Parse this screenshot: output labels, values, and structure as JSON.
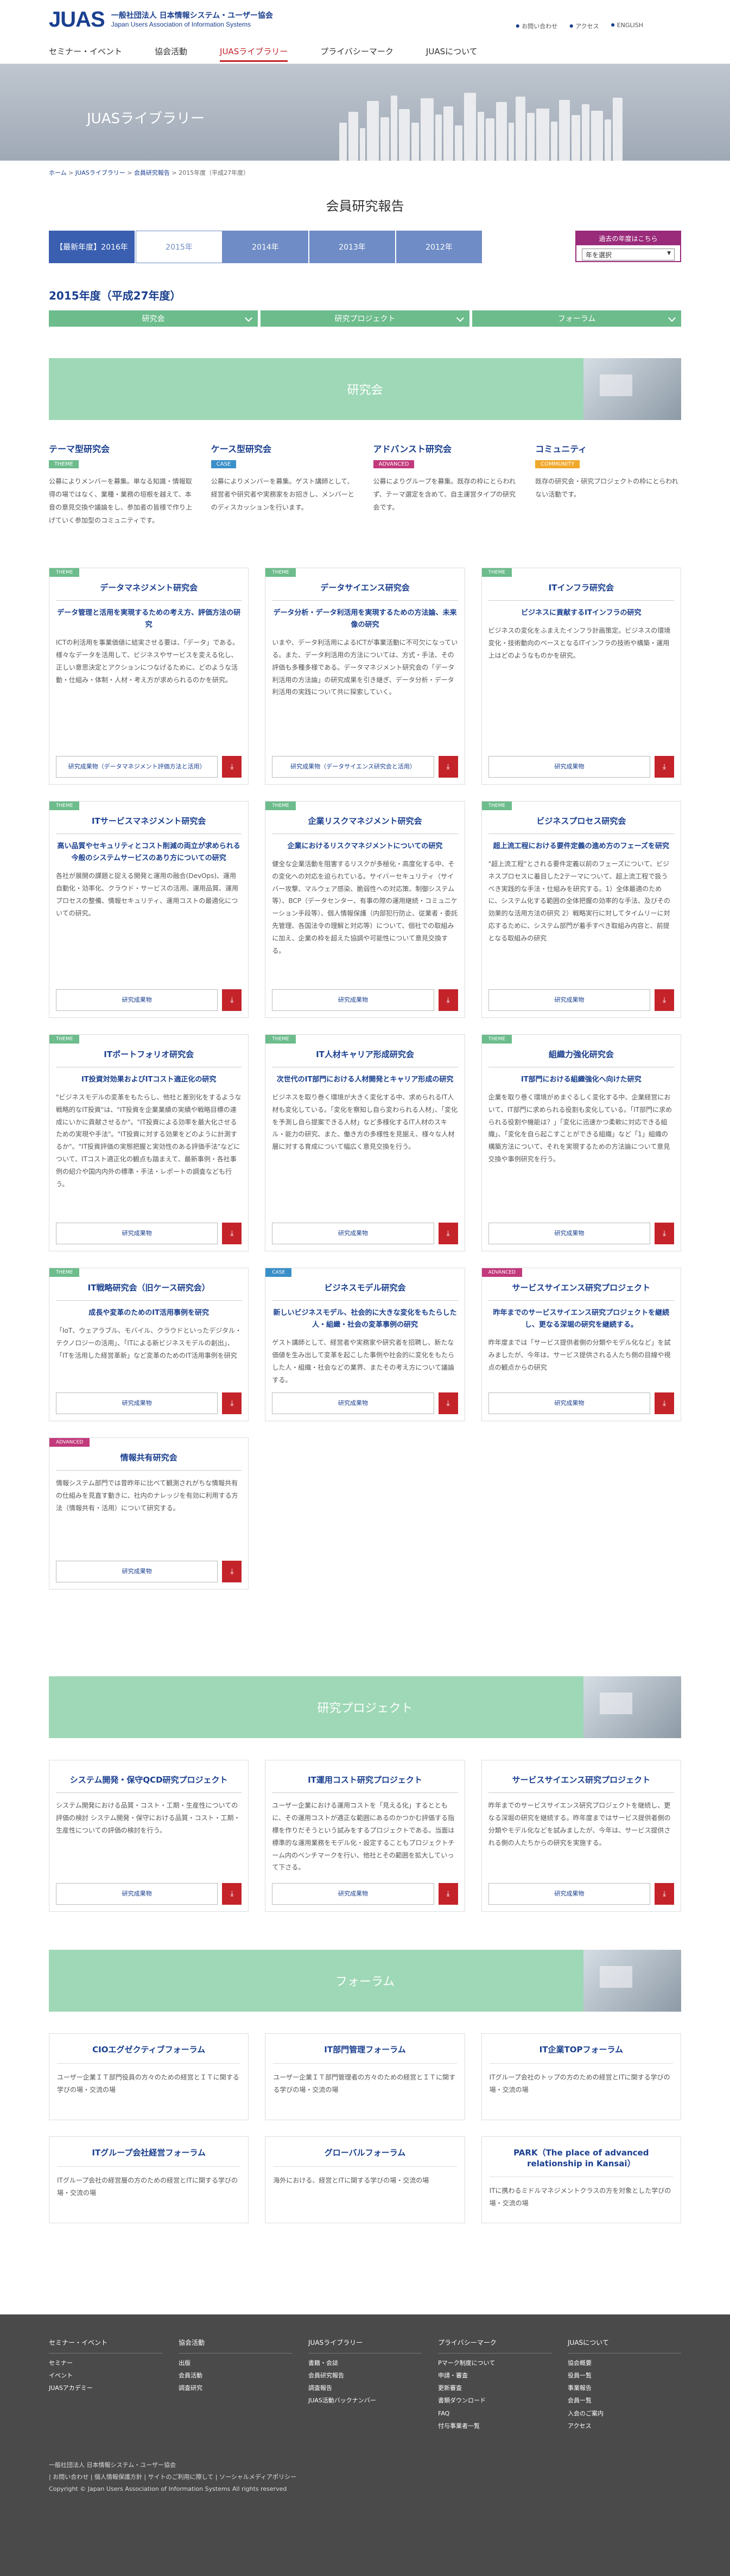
{
  "header": {
    "logo_mark": "JUAS",
    "logo_jp": "一般社団法人 日本情報システム・ユーザー協会",
    "logo_en": "Japan Users Association of Information Systems",
    "util": [
      "お問い合わせ",
      "アクセス",
      "ENGLISH"
    ],
    "nav": [
      "セミナー・イベント",
      "協会活動",
      "JUASライブラリー",
      "プライバシーマーク",
      "JUASについて"
    ]
  },
  "hero": {
    "title": "JUASライブラリー"
  },
  "breadcrumb": [
    "ホーム",
    "JUASライブラリー",
    "会員研究報告",
    "2015年度（平成27年度）"
  ],
  "page_title": "会員研究報告",
  "years": {
    "tabs": [
      "【最新年度】2016年",
      "2015年",
      "2014年",
      "2013年",
      "2012年"
    ],
    "select_header": "過去の年度はこちら",
    "select_value": "年を選択"
  },
  "year_title": "2015年度（平成27年度）",
  "categories": [
    "研究会",
    "研究プロジェクト",
    "フォーラム"
  ],
  "sections": {
    "kenkyukai": "研究会",
    "project": "研究プロジェクト",
    "forum": "フォーラム"
  },
  "intro": [
    {
      "title": "テーマ型研究会",
      "badge": "THEME",
      "text": "公募によりメンバーを募集。単なる知識・情報取得の場ではなく、業種・業務の垣根を越えて、本音の意見交換や議論をし、参加者の皆様で作り上げていく参加型のコミュニティです。"
    },
    {
      "title": "ケース型研究会",
      "badge": "CASE",
      "text": "公募によりメンバーを募集。ゲスト講師として、経営者や研究者や実務家をお招きし、メンバーとのディスカッションを行います。"
    },
    {
      "title": "アドバンスト研究会",
      "badge": "ADVANCED",
      "text": "公募によりグループを募集。既存の枠にとらわれず、テーマ選定を含めて、自主運営タイプの研究会です。"
    },
    {
      "title": "コミュニティ",
      "badge": "COMMUNITY",
      "text": "既存の研究会・研究プロジェクトの枠にとらわれない活動です。"
    }
  ],
  "cards": [
    {
      "tag": "THEME",
      "title": "データマネジメント研究会",
      "sub": "データ管理と活用を実現するための考え方、評価方法の研究",
      "body": "ICTの利活用を事業価値に結実させる要は、「データ」である。様々なデータを活用して、ビジネスやサービスを変える化し、正しい意思決定とアクションにつなげるために、どのような活動・仕組み・体制・人材・考え方が求められるのかを研究。",
      "btn": "研究成果物（データマネジメント評価方法と活用）"
    },
    {
      "tag": "THEME",
      "title": "データサイエンス研究会",
      "sub": "データ分析・データ利活用を実現するための方法論、未来像の研究",
      "body": "いまや、データ利活用によるICTが事業活動に不可欠になっている。また、データ利活用の方法については、方式・手法、その評価も多種多様である。データマネジメント研究会の「データ利活用の方法論」の研究成果を引き継ぎ、データ分析・データ利活用の実践について共に探索していく。",
      "btn": "研究成果物（データサイエンス研究会と活用）"
    },
    {
      "tag": "THEME",
      "title": "ITインフラ研究会",
      "sub": "ビジネスに貢献するITインフラの研究",
      "body": "ビジネスの変化をふまえたインフラ計画策定。ビジネスの環境変化・技術動向のベースとなるITインフラの技術や構築・運用上はどのようなものかを研究。",
      "btn": "研究成果物"
    },
    {
      "tag": "THEME",
      "title": "ITサービスマネジメント研究会",
      "sub": "高い品質やセキュリティとコスト削減の両立が求められる今般のシステムサービスのあり方についての研究",
      "body": "各社が展開の課題と捉える開発と運用の融合(DevOps)、運用自動化・効率化、クラウド・サービスの活用、運用品質、運用プロセスの整備、情報セキュリティ、運用コストの最適化についての研究。",
      "btn": "研究成果物"
    },
    {
      "tag": "THEME",
      "title": "企業リスクマネジメント研究会",
      "sub": "企業におけるリスクマネジメントについての研究",
      "body": "健全な企業活動を阻害するリスクが多極化・高度化する中、その変化への対応を迫られている。サイバーセキュリティ（サイバー攻撃、マルウェア感染、脆弱性への対応策、制御システム等）、BCP（データセンター、有事の際の運用継続・コミュニケーション手段等）、個人情報保護（内部犯行防止、従業者・委託先管理、各国法令の理解と対応等）について、個社での取組みに加え、企業の枠を超えた協調や可能性について意見交換する。",
      "btn": "研究成果物"
    },
    {
      "tag": "THEME",
      "title": "ビジネスプロセス研究会",
      "sub": "超上流工程における要件定義の進め方のフェーズを研究",
      "body": "\"超上流工程\"とされる要件定義以前のフェーズについて、ビジネスプロセスに着目した2テーマについて、超上流工程で扱うべき実践的な手法・仕組みを研究する。1）全体最適のために、システム化する範囲の全体把握の効率的な手法、及びその効果的な活用方法の研究 2）戦略実行に対してタイムリーに対応するために、システム部門が着手すべき取組み内容と、前提となる取組みの研究",
      "btn": "研究成果物"
    },
    {
      "tag": "THEME",
      "title": "ITポートフォリオ研究会",
      "sub": "IT投資対効果およびITコスト適正化の研究",
      "body": "\"ビジネスモデルの変革をもたらし、他社と差別化をするような戦略的なIT投資\"は、\"IT投資を企業業績の実績や戦略目標の達成にいかに貢献させるか\"。\"IT投資による効率を最大化させるための実現や手法\"。\"IT投資に対する効果をどのように計測するか\"。\"IT投資評価の実態把握と実効性のある評価手法\"などについて、ITコスト適正化の観点も踏まえて、最新事例・各社事例の紹介や国内内外の標準・手法・レポートの調査なども行う。",
      "btn": "研究成果物"
    },
    {
      "tag": "THEME",
      "title": "IT人材キャリア形成研究会",
      "sub": "次世代のIT部門における人材開発とキャリア形成の研究",
      "body": "ビジネスを取り巻く環境が大きく変化する中、求められるIT人材も変化している。「変化を察知し自ら変わられる人材」、「変化を予測し自ら提案できる人材」など多様化するIT人材のスキル・能力の研究、また、働き方の多様性を見据え、様々な人材層に対する育成について幅広く意見交換を行う。",
      "btn": "研究成果物"
    },
    {
      "tag": "THEME",
      "title": "組織力強化研究会",
      "sub": "IT部門における組織強化へ向けた研究",
      "body": "企業を取り巻く環境がめまぐるしく変化する中、企業経営において、IT部門に求められる役割も変化している。「IT部門に求められる役割や機能は？」「変化に迅速かつ柔軟に対応できる組織」、「変化を自ら起こすことができる組織」など「1」組織の構築方法について、それを実現するための方法論について意見交換や事例研究を行う。",
      "btn": "研究成果物"
    },
    {
      "tag": "THEME",
      "title": "IT戦略研究会（旧ケース研究会）",
      "sub": "成長や変革のためのIT活用事例を研究",
      "body": "「IoT、ウェアラブル、モバイル、クラウドといったデジタル・テクノロジーの活用」、「ITによる新ビジネスモデルの創出」、「ITを活用した経営革新」など変革のためのIT活用事例を研究",
      "btn": "研究成果物"
    },
    {
      "tag": "CASE",
      "title": "ビジネスモデル研究会",
      "sub": "新しいビジネスモデル、社会的に大きな変化をもたらした人・組織・社会の変革事例の研究",
      "body": "ゲスト講師として、経営者や実務家や研究者を招聘し、新たな価値を生み出して変革を起こした事例や社会的に変化をもたらした人・組織・社会などの業界、またその考え方について議論する。",
      "btn": "研究成果物"
    },
    {
      "tag": "ADVANCED",
      "title": "サービスサイエンス研究プロジェクト",
      "sub": "昨年までのサービスサイエンス研究プロジェクトを継続し、更なる深堀の研究を継続する。",
      "body": "昨年度までは「サービス提供者側の分類やモデル化など」を試みましたが、今年は、サービス提供される人たち側の目線や視点の観点からの研究",
      "btn": "研究成果物"
    },
    {
      "tag": "ADVANCED",
      "title": "情報共有研究会",
      "sub": "",
      "body": "情報システム部門では昔昨年に比べて観測されがちな情報共有の仕組みを見直す動きに、社内のナレッジを有効に利用する方法（情報共有・活用）について研究する。",
      "btn": "研究成果物"
    }
  ],
  "projects": [
    {
      "title": "システム開発・保守QCD研究プロジェクト",
      "body": "システム開発における品質・コスト・工期・生産性についての評価の検討 システム開発・保守における品質・コスト・工期・生産性についての評価の検討を行う。",
      "btn": "研究成果物"
    },
    {
      "title": "IT運用コスト研究プロジェクト",
      "body": "ユーザー企業における運用コストを「見える化」するとともに、その運用コストが適正な範囲にあるのかつかむ評価する指標を作りだそうという試みをするプロジェクトである。当面は標準的な運用業務をモデル化・設定することもプロジェクトチーム内のベンチマークを行い、他社とその範囲を拡大していって下さる。",
      "btn": "研究成果物"
    },
    {
      "title": "サービスサイエンス研究プロジェクト",
      "body": "昨年までのサービスサイエンス研究プロジェクトを継続し、更なる深堀の研究を継続する。昨年度まではサービス提供者側の分類やモデル化などを試みましたが、今年は、サービス提供される側の人たちからの研究を実施する。",
      "btn": "研究成果物"
    }
  ],
  "forums": [
    {
      "title": "CIOエグゼクティブフォーラム",
      "body": "ユーザー企業ＩＴ部門役員の方々のための経営とＩＴに関する学びの場・交流の場"
    },
    {
      "title": "IT部門管理フォーラム",
      "body": "ユーザー企業ＩＴ部門管理者の方々のための経営とＩＴに関する学びの場・交流の場"
    },
    {
      "title": "IT企業TOPフォーラム",
      "body": "ITグループ会社のトップの方のための経営とITに関する学びの場・交流の場"
    },
    {
      "title": "ITグループ会社経営フォーラム",
      "body": "ITグループ会社の経営層の方のための経営とITに関する学びの場・交流の場"
    },
    {
      "title": "グローバルフォーラム",
      "body": "海外における、経営とITに関する学びの場・交流の場"
    },
    {
      "title": "PARK（The place of advanced relationship in Kansai）",
      "body": "ITに携わるミドルマネジメントクラスの方を対象とした学びの場・交流の場"
    }
  ],
  "footer": {
    "cols": [
      {
        "h": "セミナー・イベント",
        "items": [
          "セミナー",
          "イベント",
          "JUASアカデミー"
        ]
      },
      {
        "h": "協会活動",
        "items": [
          "出版",
          "会員活動",
          "調査研究"
        ]
      },
      {
        "h": "JUASライブラリー",
        "items": [
          "書籍・会誌",
          "会員研究報告",
          "調査報告",
          "JUAS活動バックナンバー"
        ]
      },
      {
        "h": "プライバシーマーク",
        "items": [
          "Pマーク制度について",
          "申請・審査",
          "更新審査",
          "書類ダウンロード",
          "FAQ",
          "付与事業者一覧"
        ]
      },
      {
        "h": "JUASについて",
        "items": [
          "協会概要",
          "役員一覧",
          "事業報告",
          "会員一覧",
          "入会のご案内",
          "アクセス"
        ]
      }
    ],
    "org": "一般社団法人 日本情報システム・ユーザー協会",
    "links": "| お問い合わせ | 個人情報保護方針 | サイトのご利用に際して | ソーシャルメディアポリシー",
    "copyright": "Copyright © Japan Users Association of Information Systems All rights reserved"
  }
}
